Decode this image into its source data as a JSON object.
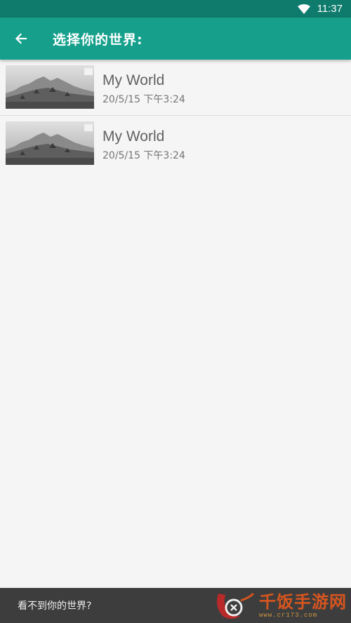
{
  "status_bar": {
    "time": "11:37",
    "icons": [
      "wifi-icon"
    ]
  },
  "app_bar": {
    "back_icon": "arrow-left-icon",
    "title": "选择你的世界:"
  },
  "worlds": [
    {
      "name": "My World",
      "date": "20/5/15 下午3:24",
      "thumbnail": "world-thumbnail"
    },
    {
      "name": "My World",
      "date": "20/5/15 下午3:24",
      "thumbnail": "world-thumbnail"
    }
  ],
  "bottom_bar": {
    "label": "看不到你的世界?"
  },
  "watermark": {
    "main": "千饭手游网",
    "sub": "www.cr173.com"
  },
  "colors": {
    "status_bar": "#0f7b6c",
    "app_bar": "#16a08c",
    "background": "#f5f5f5",
    "bottom_bar": "#3d3d3d"
  }
}
